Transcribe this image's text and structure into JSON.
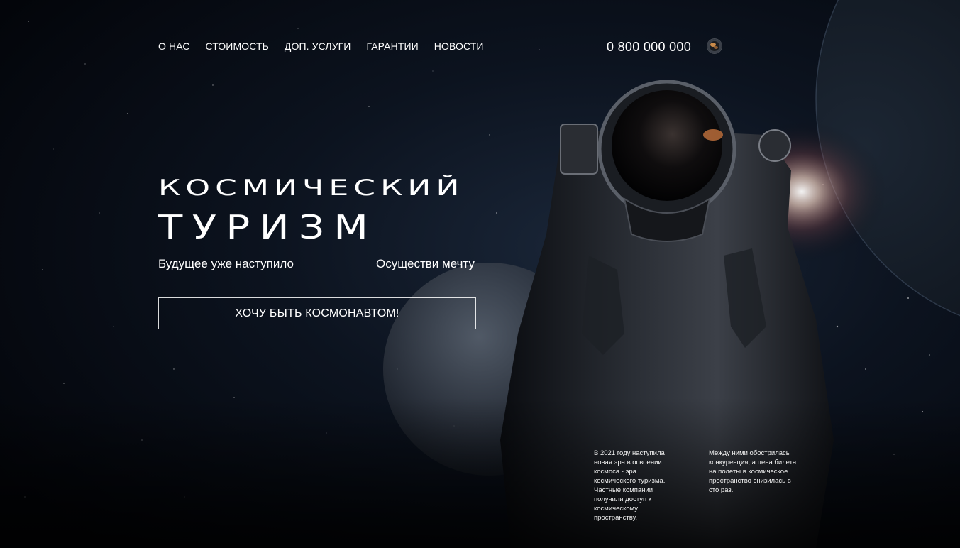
{
  "nav": {
    "items": [
      {
        "label": "О НАС"
      },
      {
        "label": "СТОИМОСТЬ"
      },
      {
        "label": "ДОП. УСЛУГИ"
      },
      {
        "label": "ГАРАНТИИ"
      },
      {
        "label": "НОВОСТИ"
      }
    ]
  },
  "header": {
    "phone": "0 800 000 000",
    "language_icon": "globe-flag-icon"
  },
  "hero": {
    "title_line1": "КОСМИЧЕСКИЙ",
    "title_line2": "ТУРИЗМ",
    "subtitle_left": "Будущее уже наступило",
    "subtitle_right": "Осуществи мечту",
    "cta_label": "ХОЧУ БЫТЬ КОСМОНАВТОМ!"
  },
  "info": {
    "paragraph_1": "В 2021 году наступила новая эра в освоении космоса - эра космического туризма. Частные компании получили доступ к космическому пространству.",
    "paragraph_2": "Между ними обострилась конкуренция, а цена билета на полеты в космическое пространство снизилась в сто раз."
  },
  "colors": {
    "background": "#05070c",
    "text": "#ffffff",
    "button_border": "#ffffff"
  }
}
